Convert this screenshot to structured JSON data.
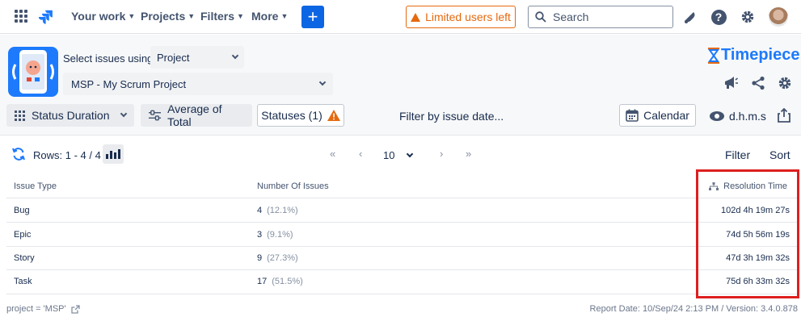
{
  "topnav": {
    "items": [
      {
        "label": "Your work"
      },
      {
        "label": "Projects"
      },
      {
        "label": "Filters"
      },
      {
        "label": "More"
      }
    ],
    "create_label": "+",
    "limited_label": "Limited users left",
    "search_placeholder": "Search",
    "colors": {
      "accent": "#0c66e4",
      "warning": "#e56910"
    }
  },
  "header": {
    "select_label": "Select issues using",
    "select_mode": "Project",
    "project": "MSP - My Scrum Project",
    "brand": "Timepiece",
    "report_type": "Status Duration",
    "calc_type": "Average of Total",
    "statuses": "Statuses (1)",
    "filter_date": "Filter by issue date...",
    "calendar": "Calendar",
    "time_format": "d.h.m.s"
  },
  "rows_bar": {
    "rows_text": "Rows: 1 - 4 / 4",
    "page_size": "10",
    "pager": {
      "first": "«",
      "prev": "‹",
      "next": "›",
      "last": "»"
    },
    "filter": "Filter",
    "sort": "Sort"
  },
  "table": {
    "headers": {
      "issue_type": "Issue Type",
      "count": "Number Of Issues",
      "resolution": "Resolution Time"
    },
    "rows": [
      {
        "type": "Bug",
        "count": "4",
        "pct": "(12.1%)",
        "resolution": "102d 4h 19m 27s"
      },
      {
        "type": "Epic",
        "count": "3",
        "pct": "(9.1%)",
        "resolution": "74d 5h 56m 19s"
      },
      {
        "type": "Story",
        "count": "9",
        "pct": "(27.3%)",
        "resolution": "47d 3h 19m 32s"
      },
      {
        "type": "Task",
        "count": "17",
        "pct": "(51.5%)",
        "resolution": "75d 6h 33m 32s"
      }
    ]
  },
  "footer": {
    "query": "project = 'MSP'",
    "report_info": "Report Date: 10/Sep/24 2:13 PM / Version: 3.4.0.878"
  }
}
